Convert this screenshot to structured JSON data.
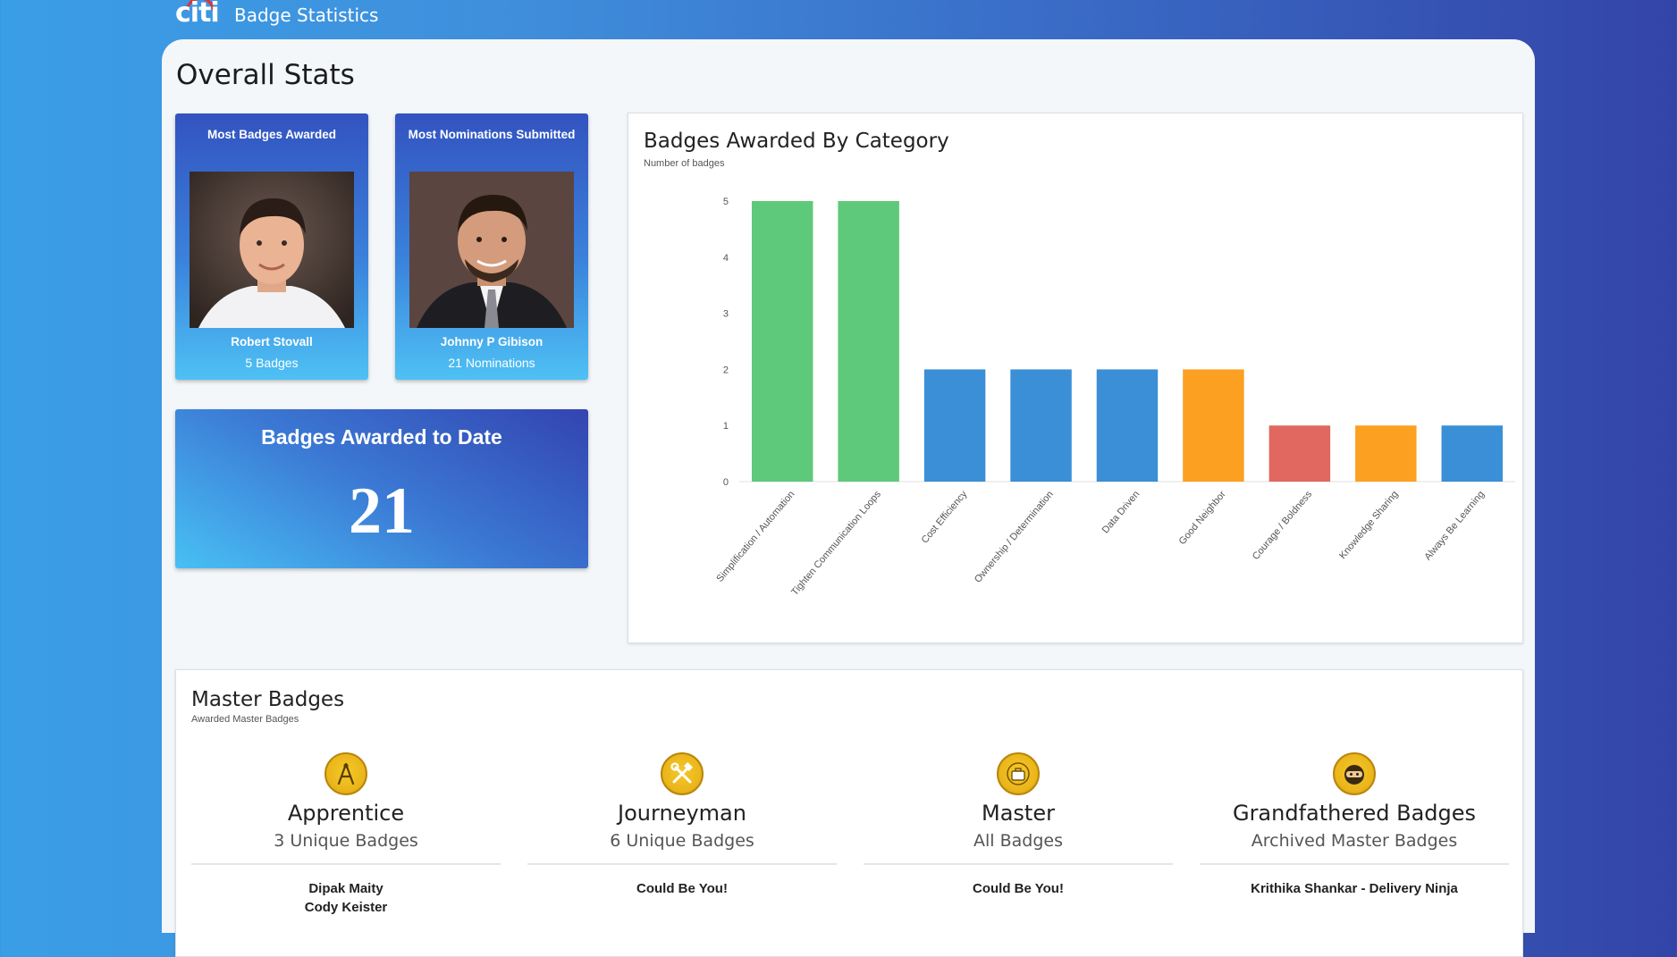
{
  "app": {
    "logo_text": "citi",
    "title": "Badge Statistics"
  },
  "page": {
    "title": "Overall Stats"
  },
  "most_badges": {
    "title": "Most Badges Awarded",
    "name": "Robert Stovall",
    "stat": "5 Badges"
  },
  "most_nominations": {
    "title": "Most Nominations Submitted",
    "name": "Johnny P Gibison",
    "stat": "21 Nominations"
  },
  "awarded_to_date": {
    "label": "Badges Awarded to Date",
    "value": "21"
  },
  "chart_data": {
    "type": "bar",
    "title": "Badges Awarded By Category",
    "subtitle": "Number of badges",
    "categories": [
      "Simplification / Automation",
      "Tighten Communication Loops",
      "Cost Efficiency",
      "Ownership / Determination",
      "Data Driven",
      "Good Neighbor",
      "Courage / Boldness",
      "Knowledge Sharing",
      "Always Be Learning"
    ],
    "values": [
      5,
      5,
      2,
      2,
      2,
      2,
      1,
      1,
      1
    ],
    "colors": [
      "#5ec97a",
      "#5ec97a",
      "#3a8fd6",
      "#3a8fd6",
      "#3a8fd6",
      "#fca022",
      "#e06860",
      "#fca022",
      "#3a8fd6"
    ],
    "ylim": [
      0,
      5
    ],
    "yticks": [
      0,
      1,
      2,
      3,
      4,
      5
    ],
    "grid": false
  },
  "master": {
    "title": "Master Badges",
    "subtitle": "Awarded Master Badges",
    "tiers": [
      {
        "name": "Apprentice",
        "desc": "3 Unique Badges",
        "recipients": [
          "Dipak Maity",
          "Cody Keister"
        ],
        "icon": "compass-icon"
      },
      {
        "name": "Journeyman",
        "desc": "6 Unique Badges",
        "recipients": [
          "Could Be You!"
        ],
        "icon": "tools-icon"
      },
      {
        "name": "Master",
        "desc": "All Badges",
        "recipients": [
          "Could Be You!"
        ],
        "icon": "briefcase-icon"
      },
      {
        "name": "Grandfathered Badges",
        "desc": "Archived Master Badges",
        "recipients": [
          "Krithika Shankar - Delivery Ninja"
        ],
        "icon": "ninja-icon"
      }
    ]
  }
}
